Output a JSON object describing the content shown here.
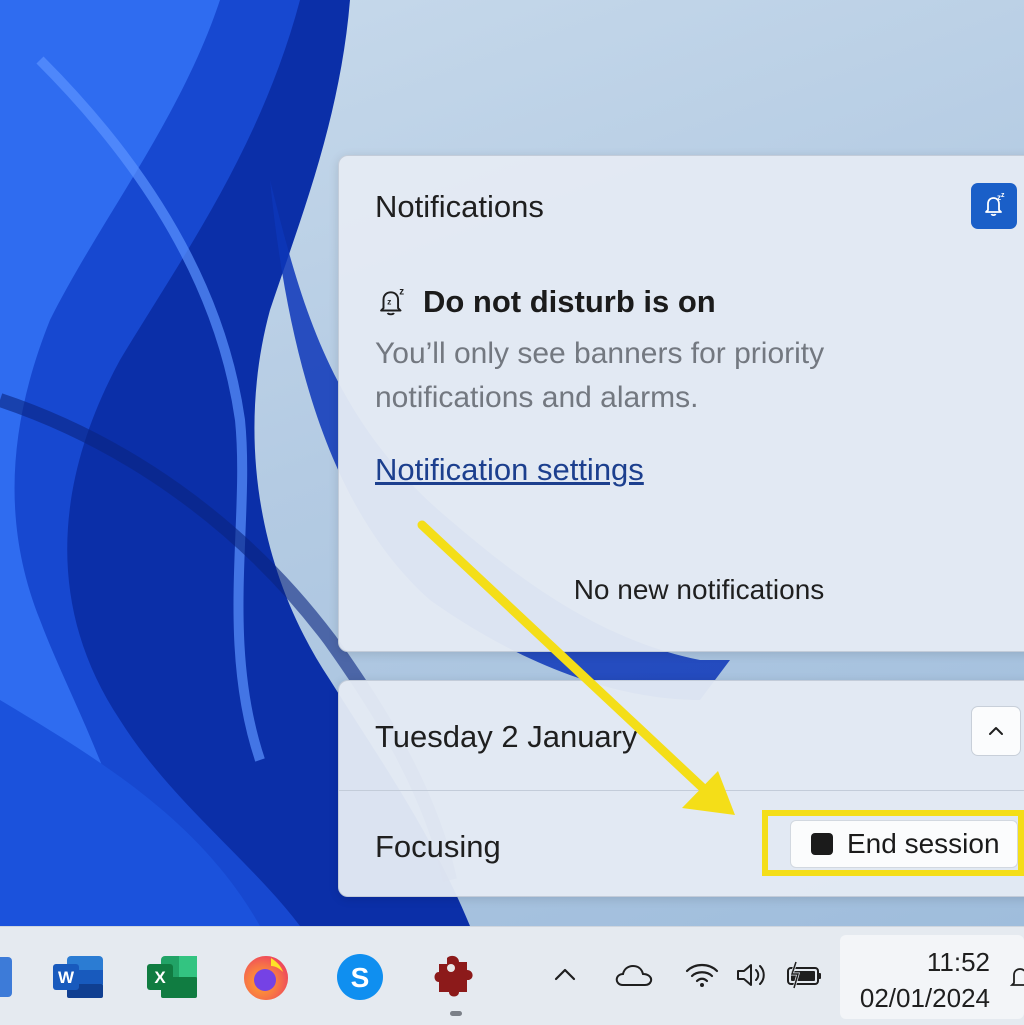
{
  "notifications_panel": {
    "title": "Notifications",
    "dnd_heading": "Do not disturb is on",
    "dnd_description": "You’ll only see banners for priority notifications and alarms.",
    "settings_link": "Notification settings",
    "empty_message": "No new notifications",
    "dnd_toggle_icon": "bell-snooze-icon",
    "dnd_toggle_active": true,
    "accent_color": "#1a5fc8"
  },
  "calendar_panel": {
    "date": "Tuesday 2 January",
    "collapse_icon": "chevron-up-icon"
  },
  "focus_session": {
    "label": "Focusing",
    "end_button_label": "End session",
    "highlight_color": "#f4de18"
  },
  "taskbar": {
    "apps": [
      {
        "name": "word",
        "icon": "word-icon"
      },
      {
        "name": "excel",
        "icon": "excel-icon"
      },
      {
        "name": "firefox",
        "icon": "firefox-icon"
      },
      {
        "name": "skype",
        "icon": "skype-icon"
      },
      {
        "name": "app",
        "icon": "puzzle-icon"
      }
    ],
    "tray_icons": [
      "chevron-up-icon",
      "cloud-icon",
      "wifi-icon",
      "volume-icon",
      "battery-icon"
    ],
    "clock": {
      "time": "11:52",
      "date": "02/01/2024"
    }
  }
}
